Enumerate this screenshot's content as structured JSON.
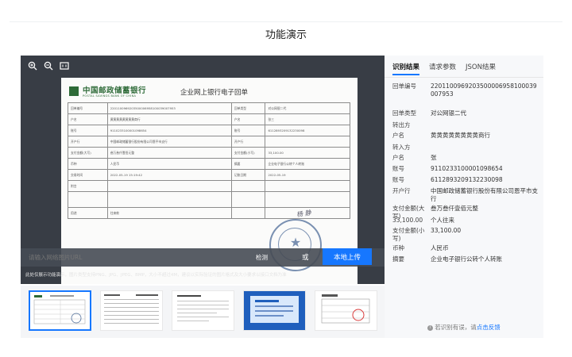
{
  "page": {
    "title": "功能演示"
  },
  "viewer": {
    "url_placeholder": "请输入网络图片URL",
    "detect_label": "检测",
    "or_label": "或",
    "upload_label": "本地上传",
    "hint": "此处仅展示功能演示，图片类型支持PNG、JPG、JPEG、BMP，大小不超过4M，建议以实际验证的图片格式及大小要求以接口文档为准",
    "tools": [
      "zoom-in-icon",
      "zoom-out-icon",
      "fit-screen-icon"
    ]
  },
  "receipt": {
    "bank_name": "中国邮政储蓄银行",
    "bank_name_en": "POSTAL SAVINGS BANK OF CHINA",
    "title": "企业网上银行电子回单",
    "signature": "杨 静",
    "stamp_text": "中国邮政储蓄银行",
    "rows": [
      [
        "回单编号",
        "2201100969203500006958100039007953",
        "回单类型",
        "对公网银二代"
      ],
      [
        "户名",
        "黄黄黄黄黄黄黄黄商行",
        "户名",
        "张三"
      ],
      [
        "账号",
        "9110233100001098654",
        "账号",
        "6112893209132230098"
      ],
      [
        "开户行",
        "中国邮政储蓄银行股份有限公司恩平市支行",
        "开户行",
        ""
      ],
      [
        "支付金额(大写)",
        "叁万叁仟壹佰元整",
        "支付金额(小写)",
        "33,100.00"
      ],
      [
        "币种",
        "人民币",
        "摘要",
        "企业电子银行公转个人转账"
      ],
      [
        "交易时间",
        "2022-05-19 15:19:42",
        "记账日期",
        "2022-05-19"
      ],
      [
        "附言",
        "",
        "",
        ""
      ],
      [
        "",
        "",
        "",
        ""
      ],
      [
        "用途",
        "往来款",
        "",
        ""
      ]
    ]
  },
  "results": {
    "tabs": [
      "识别结果",
      "请求参数",
      "JSON结果"
    ],
    "active_tab": 0,
    "rows": [
      {
        "key": "回单编号",
        "value": "2201100969203500006958100039007953"
      },
      {
        "key": "回单类型",
        "value": "对公网银二代"
      },
      {
        "key": "转出方",
        "value": ""
      },
      {
        "key": "户名",
        "value": "黄黄黄黄黄黄黄黄商行"
      },
      {
        "key": "转入方",
        "value": ""
      },
      {
        "key": "户名",
        "value": "张"
      },
      {
        "key": "账号",
        "value": "9110233100001098654"
      },
      {
        "key": "账号",
        "value": "6112893209132230098"
      },
      {
        "key": "开户行",
        "value": "中国邮政储蓄银行股份有限公司恩平市支行"
      },
      {
        "key": "支付金额(大写)",
        "value": "叁万叁仟壹佰元整"
      },
      {
        "key": "33,100.00",
        "value": "个人往来"
      },
      {
        "key": "支付金额(小写)",
        "value": "33,100.00"
      },
      {
        "key": "币种",
        "value": "人民币"
      },
      {
        "key": "摘要",
        "value": "企业电子银行公转个人转账"
      }
    ],
    "feedback_text": "若识别有误，请",
    "feedback_link": "点击反馈"
  },
  "colors": {
    "accent": "#1677ff",
    "bank_green": "#2d6a37",
    "stamp_blue": "#4f6d99",
    "viewer_bg": "#383d45"
  }
}
